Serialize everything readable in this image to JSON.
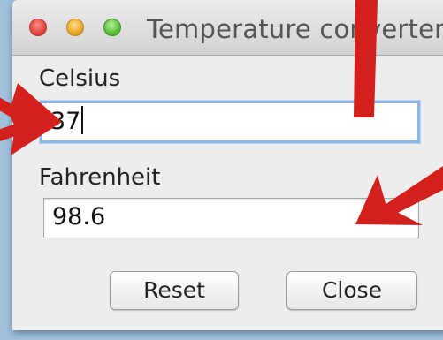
{
  "window": {
    "title": "Temperature converter"
  },
  "celsius": {
    "label": "Celsius",
    "value": "37"
  },
  "fahrenheit": {
    "label": "Fahrenheit",
    "value": "98.6"
  },
  "buttons": {
    "reset": "Reset",
    "close": "Close"
  },
  "annotations": {
    "arrow_color": "#d4201c"
  }
}
